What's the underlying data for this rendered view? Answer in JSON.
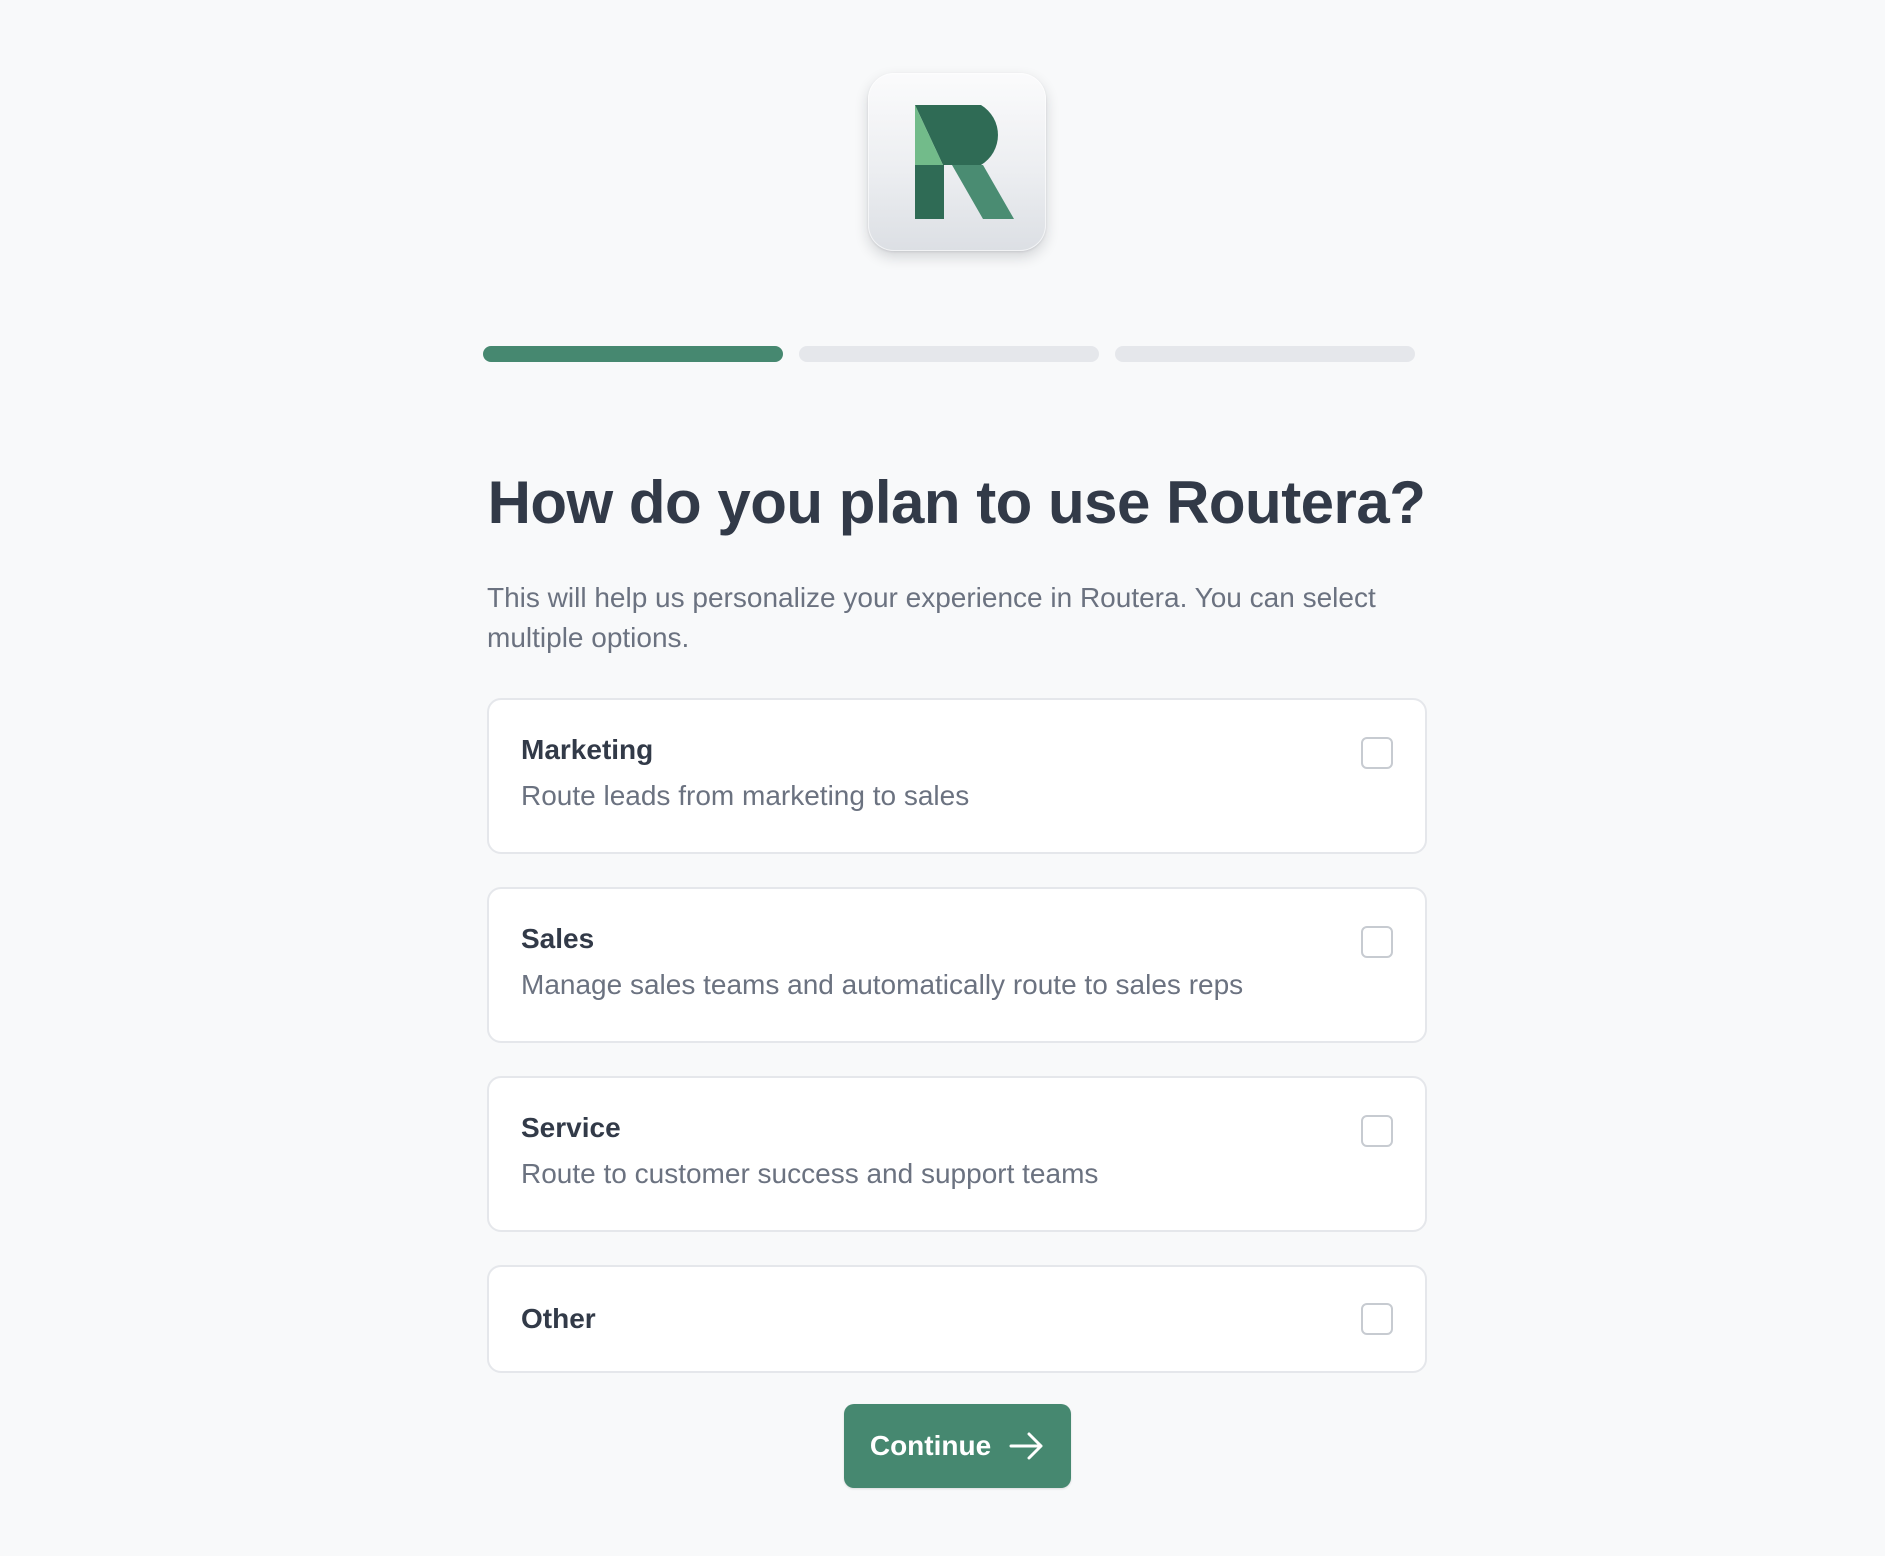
{
  "brand": {
    "name": "Routera",
    "logo_icon": "routera-r-logo",
    "colors": {
      "accent": "#468870",
      "logo_dark": "#2f6b55",
      "logo_light": "#72bb8a",
      "logo_mid": "#4a8c72"
    }
  },
  "progress": {
    "total_steps": 3,
    "current_step": 1
  },
  "heading": {
    "title": "How do you plan to use Routera?",
    "subtitle": "This will help us personalize your experience in Routera. You can select multiple options."
  },
  "options": [
    {
      "label": "Marketing",
      "description": "Route leads from marketing to sales",
      "checked": false
    },
    {
      "label": "Sales",
      "description": "Manage sales teams and automatically route to sales reps",
      "checked": false
    },
    {
      "label": "Service",
      "description": "Route to customer success and support teams",
      "checked": false
    },
    {
      "label": "Other",
      "checked": false
    }
  ],
  "actions": {
    "continue_label": "Continue",
    "continue_icon": "arrow-right-icon"
  }
}
